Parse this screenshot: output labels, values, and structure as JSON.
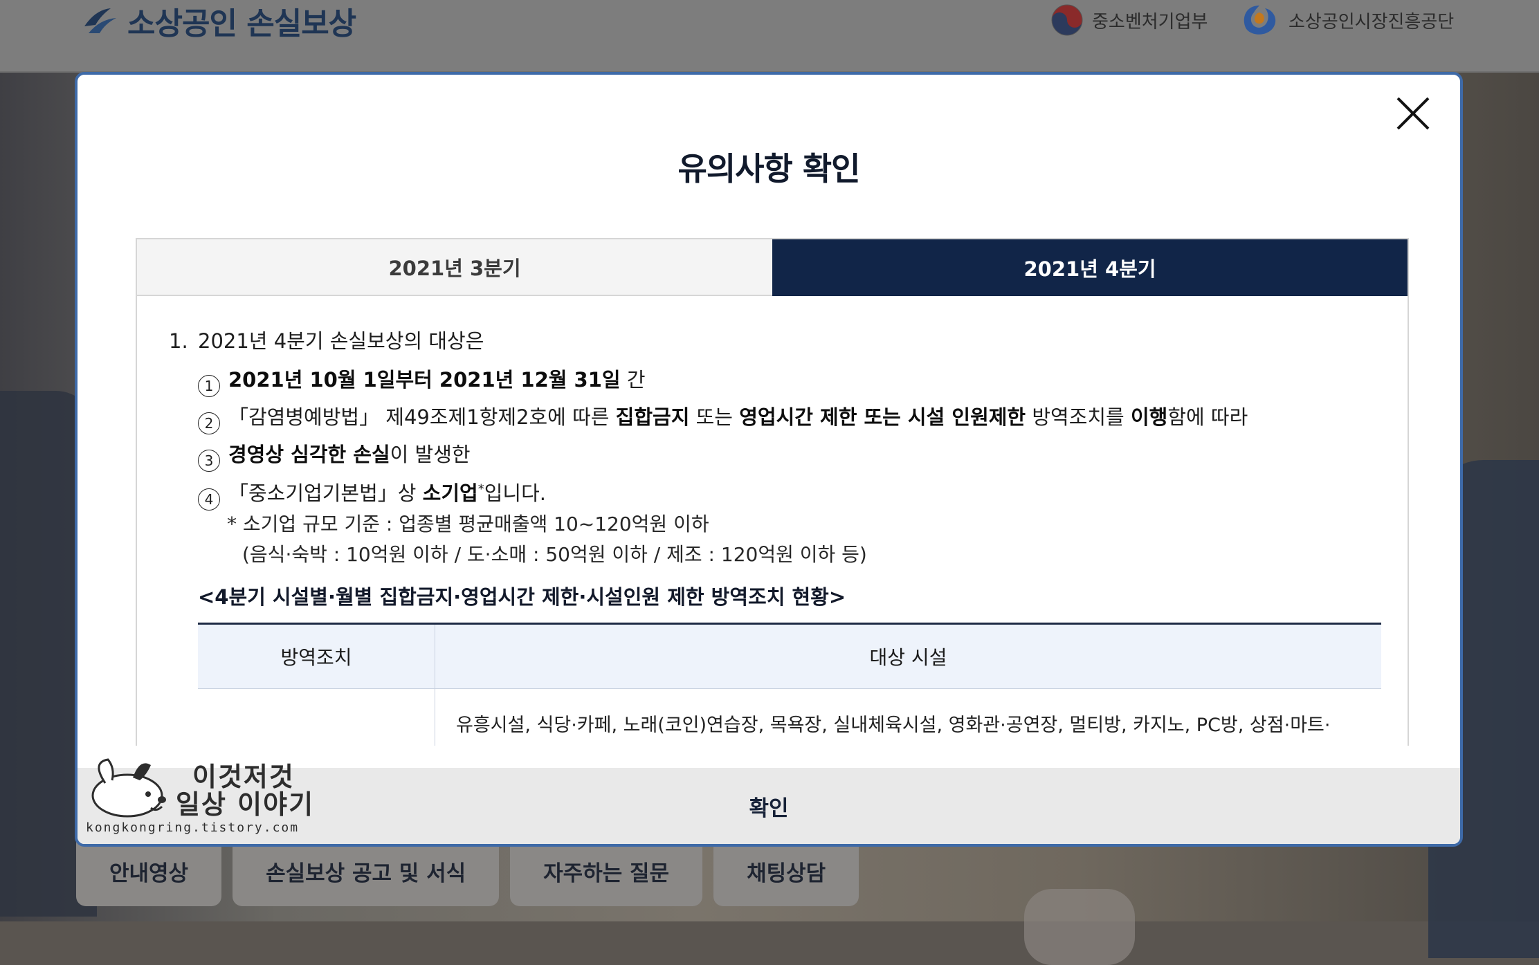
{
  "header": {
    "logo_text": "소상공인 손실보상",
    "partners": [
      {
        "name": "중소벤처기업부",
        "icon": "taegeuk-icon"
      },
      {
        "name": "소상공인시장진흥공단",
        "icon": "semas-logo-icon"
      }
    ]
  },
  "bottom_tabs": [
    "안내영상",
    "손실보상 공고 및 서식",
    "자주하는 질문",
    "채팅상담"
  ],
  "modal": {
    "title": "유의사항 확인",
    "tabs": [
      {
        "label": "2021년 3분기",
        "active": false
      },
      {
        "label": "2021년 4분기",
        "active": true
      }
    ],
    "item1": {
      "number": "1.",
      "text": "2021년 4분기 손실보상의 대상은",
      "subs": [
        {
          "mark": "1",
          "b1": "2021년 10월 1일부터 2021년 12월 31일",
          "t1": " 간"
        },
        {
          "mark": "2",
          "t0": "「감염병예방법」 제49조제1항제2호에 따른 ",
          "b1": "집합금지",
          "t1": " 또는 ",
          "b2": "영업시간 제한 또는 시설 인원제한",
          "t2": " 방역조치를 ",
          "b3": "이행",
          "t3": "함에 따라"
        },
        {
          "mark": "3",
          "b1": "경영상 심각한 손실",
          "t1": "이 발생한"
        },
        {
          "mark": "4",
          "t0": "「중소기업기본법」상 ",
          "b1": "소기업",
          "sup": "*",
          "t1": "입니다."
        }
      ],
      "note1": "* 소기업 규모 기준 : 업종별 평균매출액 10~120억원 이하",
      "note2": "(음식·숙박 : 10억원 이하 / 도·소매 : 50억원 이하 / 제조 : 120억원 이하 등)"
    },
    "table_title": "<4분기 시설별·월별 집합금지·영업시간 제한·시설인원 제한 방역조치 현황>",
    "table": {
      "headers": [
        "방역조치",
        "대상 시설"
      ],
      "row1_c2": "유흥시설, 식당·카페, 노래(코인)연습장, 목욕장, 실내체육시설, 영화관·공연장, 멀티방, 카지노, PC방, 상점·마트·"
    },
    "confirm_label": "확인"
  },
  "watermark": {
    "line1": "이것저것",
    "line2": "일상 이야기",
    "url": "kongkongring.tistory.com"
  }
}
